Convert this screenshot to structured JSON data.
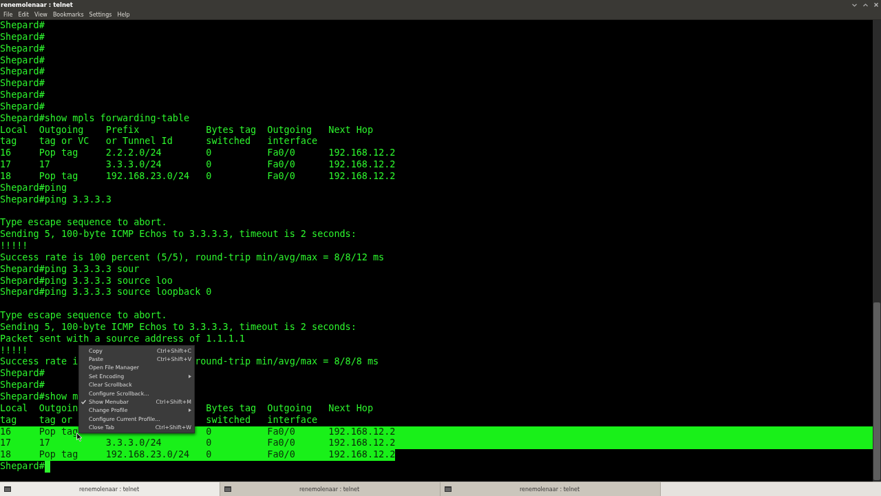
{
  "window": {
    "title": "renemolenaar : telnet"
  },
  "menu_bar": [
    "File",
    "Edit",
    "View",
    "Bookmarks",
    "Settings",
    "Help"
  ],
  "terminal": {
    "lines": [
      {
        "kind": "text",
        "selected": false,
        "segments": [
          {
            "text": "Shepard#"
          }
        ]
      },
      {
        "kind": "text",
        "selected": false,
        "segments": [
          {
            "text": "Shepard#"
          }
        ]
      },
      {
        "kind": "text",
        "selected": false,
        "segments": [
          {
            "text": "Shepard#"
          }
        ]
      },
      {
        "kind": "text",
        "selected": false,
        "segments": [
          {
            "text": "Shepard#"
          }
        ]
      },
      {
        "kind": "text",
        "selected": false,
        "segments": [
          {
            "text": "Shepard#"
          }
        ]
      },
      {
        "kind": "text",
        "selected": false,
        "segments": [
          {
            "text": "Shepard#"
          }
        ]
      },
      {
        "kind": "text",
        "selected": false,
        "segments": [
          {
            "text": "Shepard#"
          }
        ]
      },
      {
        "kind": "text",
        "selected": false,
        "segments": [
          {
            "text": "Shepard#"
          }
        ]
      },
      {
        "kind": "text",
        "selected": false,
        "segments": [
          {
            "text": "Shepard#show mpls forwarding-table"
          }
        ]
      },
      {
        "kind": "text",
        "selected": false,
        "segments": [
          {
            "text": "Local  Outgoing    Prefix            Bytes tag  Outgoing   Next Hop"
          }
        ]
      },
      {
        "kind": "text",
        "selected": false,
        "segments": [
          {
            "text": "tag    tag or VC   or Tunnel Id      switched   interface"
          }
        ]
      },
      {
        "kind": "text",
        "selected": false,
        "segments": [
          {
            "text": "16     Pop tag     2.2.2.0/24        0          Fa0/0      192.168.12.2"
          }
        ]
      },
      {
        "kind": "text",
        "selected": false,
        "segments": [
          {
            "text": "17     17          3.3.3.0/24        0          Fa0/0      192.168.12.2"
          }
        ]
      },
      {
        "kind": "text",
        "selected": false,
        "segments": [
          {
            "text": "18     Pop tag     192.168.23.0/24   0          Fa0/0      192.168.12.2"
          }
        ]
      },
      {
        "kind": "text",
        "selected": false,
        "segments": [
          {
            "text": "Shepard#ping"
          }
        ]
      },
      {
        "kind": "text",
        "selected": false,
        "segments": [
          {
            "text": "Shepard#ping 3.3.3.3"
          }
        ]
      },
      {
        "kind": "blank",
        "selected": false
      },
      {
        "kind": "text",
        "selected": false,
        "segments": [
          {
            "text": "Type escape sequence to abort."
          }
        ]
      },
      {
        "kind": "text",
        "selected": false,
        "segments": [
          {
            "text": "Sending 5, 100-byte ICMP Echos to 3.3.3.3, timeout is 2 seconds:"
          }
        ]
      },
      {
        "kind": "text",
        "selected": false,
        "segments": [
          {
            "text": "!!!!!"
          }
        ]
      },
      {
        "kind": "text",
        "selected": false,
        "segments": [
          {
            "text": "Success rate is 100 percent (5/5), round-trip min/avg/max = 8/8/12 ms"
          }
        ]
      },
      {
        "kind": "text",
        "selected": false,
        "segments": [
          {
            "text": "Shepard#ping 3.3.3.3 sour"
          }
        ]
      },
      {
        "kind": "text",
        "selected": false,
        "segments": [
          {
            "text": "Shepard#ping 3.3.3.3 source loo"
          }
        ]
      },
      {
        "kind": "text",
        "selected": false,
        "segments": [
          {
            "text": "Shepard#ping 3.3.3.3 source loopback 0"
          }
        ]
      },
      {
        "kind": "blank",
        "selected": false
      },
      {
        "kind": "text",
        "selected": false,
        "segments": [
          {
            "text": "Type escape sequence to abort."
          }
        ]
      },
      {
        "kind": "text",
        "selected": false,
        "segments": [
          {
            "text": "Sending 5, 100-byte ICMP Echos to 3.3.3.3, timeout is 2 seconds:"
          }
        ]
      },
      {
        "kind": "text",
        "selected": false,
        "segments": [
          {
            "text": "Packet sent with a source address of 1.1.1.1"
          }
        ]
      },
      {
        "kind": "text",
        "selected": false,
        "segments": [
          {
            "text": "!!!!!"
          }
        ]
      },
      {
        "kind": "text",
        "selected": false,
        "segments": [
          {
            "text": "Success rate i"
          },
          {
            "text": "round-trip min/avg/max = 8/8/8 ms",
            "kind": "reply"
          }
        ]
      },
      {
        "kind": "text",
        "selected": false,
        "segments": [
          {
            "text": "Shepard#"
          }
        ]
      },
      {
        "kind": "text",
        "selected": false,
        "segments": [
          {
            "text": "Shepard#"
          }
        ]
      },
      {
        "kind": "text",
        "selected": false,
        "segments": [
          {
            "text": "Shepard#show m"
          }
        ]
      },
      {
        "kind": "text",
        "selected": false,
        "segments": [
          {
            "text": "Local  Outgoin"
          },
          {
            "text": "Bytes tag  Outgoing   Next Hop",
            "kind": "table"
          }
        ]
      },
      {
        "kind": "text",
        "selected": false,
        "segments": [
          {
            "text": "tag    tag or"
          },
          {
            "text": "switched   interface",
            "kind": "table"
          }
        ]
      },
      {
        "kind": "text",
        "selected": true,
        "full_width": true,
        "segments": [
          {
            "text": "16     Pop tag"
          },
          {
            "text": "0          Fa0/0      192.168.12.2",
            "kind": "table"
          }
        ]
      },
      {
        "kind": "text",
        "selected": true,
        "full_width": true,
        "segments": [
          {
            "text": "17     17          3.3.3.0/24        0          Fa0/0      192.168.12.2"
          }
        ]
      },
      {
        "kind": "text",
        "selected": true,
        "full_width": false,
        "segments": [
          {
            "text": "18     Pop tag     192.168.23.0/24   0          Fa0/0      192.168.12.2"
          }
        ]
      },
      {
        "kind": "prompt",
        "selected": false,
        "segments": [
          {
            "text": "Shepard#"
          }
        ]
      }
    ]
  },
  "context_menu": {
    "items": [
      {
        "label": "Copy",
        "shortcut": "Ctrl+Shift+C"
      },
      {
        "label": "Paste",
        "shortcut": "Ctrl+Shift+V"
      },
      {
        "label": "Open File Manager"
      },
      {
        "label": "Set Encoding",
        "submenu": true
      },
      {
        "label": "Clear Scrollback"
      },
      {
        "label": "Configure Scrollback..."
      },
      {
        "label": "Show Menubar",
        "shortcut": "Ctrl+Shift+M",
        "checked": true
      },
      {
        "label": "Change Profile",
        "submenu": true
      },
      {
        "label": "Configure Current Profile..."
      },
      {
        "label": "Close Tab",
        "shortcut": "Ctrl+Shift+W"
      }
    ]
  },
  "taskbar": {
    "items": [
      {
        "label": "renemolenaar : telnet",
        "selected": true
      },
      {
        "label": "renemolenaar : telnet",
        "selected": false
      },
      {
        "label": "renemolenaar : telnet",
        "selected": false
      }
    ]
  }
}
